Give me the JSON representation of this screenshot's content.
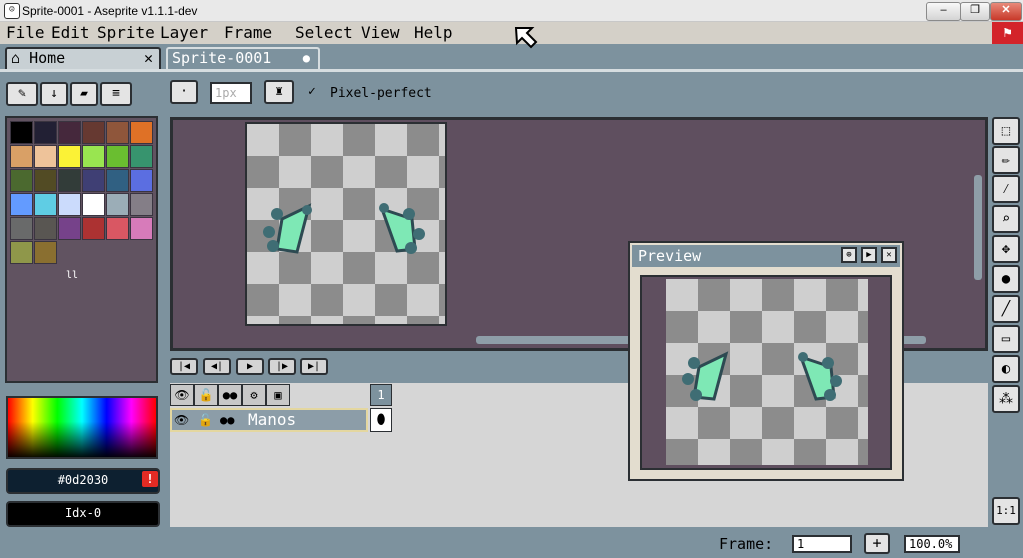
{
  "window": {
    "title": "Sprite-0001 - Aseprite v1.1.1-dev"
  },
  "menu": [
    "File",
    "Edit",
    "Sprite",
    "Layer",
    "Frame",
    "Select",
    "View",
    "Help"
  ],
  "tabs": {
    "home": "Home",
    "sprite": "Sprite-0001",
    "close_glyph": "✕",
    "modified_glyph": "●"
  },
  "toolbar": {
    "brush_size": "1px",
    "pixel_perfect_label": "Pixel-perfect"
  },
  "palette": {
    "colors": [
      "#000000",
      "#222034",
      "#45283c",
      "#663931",
      "#8f563b",
      "#df7126",
      "#d9a066",
      "#eec39a",
      "#fbf236",
      "#99e550",
      "#6abe30",
      "#37946e",
      "#4b692f",
      "#524b24",
      "#323c39",
      "#3f3f74",
      "#306082",
      "#5b6ee1",
      "#639bff",
      "#5fcde4",
      "#cbdbfc",
      "#ffffff",
      "#9badb7",
      "#847e87",
      "#696a6a",
      "#595652",
      "#76428a",
      "#ac3232",
      "#d95763",
      "#d77bba",
      "#8f974a",
      "#8a6f30"
    ],
    "selector_glyph": "ll"
  },
  "color_fields": {
    "hex": "#0d2030",
    "index": "Idx-0",
    "warning_glyph": "!"
  },
  "timeline": {
    "frame_number": "1",
    "layers": [
      {
        "name": "Manos"
      }
    ]
  },
  "preview": {
    "title": "Preview"
  },
  "status": {
    "frame_label": "Frame:",
    "frame_value": "1",
    "plus_label": "+",
    "zoom": "100.0%"
  },
  "tools": [
    "select-icon",
    "pencil-icon",
    "eyedropper-icon",
    "zoom-icon",
    "move-icon",
    "fill-icon",
    "line-icon",
    "rectangle-icon",
    "blur-icon",
    "spray-icon"
  ],
  "zoom_reset_label": "1:1"
}
